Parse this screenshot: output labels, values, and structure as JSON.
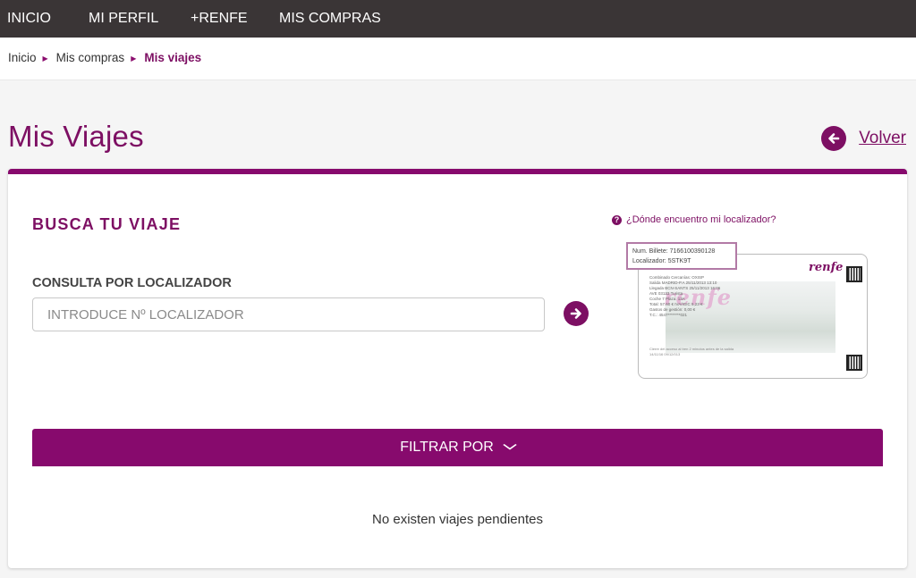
{
  "nav": {
    "items": [
      {
        "label": "INICIO"
      },
      {
        "label": "MI PERFIL"
      },
      {
        "label": "+RENFE"
      },
      {
        "label": "MIS COMPRAS"
      }
    ]
  },
  "breadcrumb": {
    "items": [
      "Inicio",
      "Mis compras"
    ],
    "current": "Mis viajes",
    "separator_icon": "triangle-right-icon"
  },
  "page": {
    "title": "Mis Viajes",
    "back_label": "Volver",
    "back_icon": "arrow-left-circle-icon"
  },
  "search": {
    "section_title": "BUSCA TU VIAJE",
    "field_label": "CONSULTA POR LOCALIZADOR",
    "placeholder": "INTRODUCE Nº LOCALIZADOR",
    "value": "",
    "submit_icon": "arrow-right-circle-icon",
    "help_link": "¿Dónde encuentro mi localizador?"
  },
  "ticket_example": {
    "callout_line1": "Num. Billete: 7166100390128",
    "callout_line2": "Localizador: 5STK9T",
    "brand": "renfe",
    "lines": [
      "Combinado Cercanías: OXISP",
      "Salida        MADRID-P.A       25/11/2013      13:10",
      "Llegada       BCN-SANTS        25/11/2013      16:06",
      "AVE           03133            Turista",
      "Coche         7                Plaza: 13A",
      "",
      "                Total: 57,60 € IVA/IGIC 5,23 €",
      "                Gastos de gestión: 0,00 €"
    ],
    "footer_lines": [
      "Cierre del acceso al tren 2 minutos antes de la salida",
      "14/11/16 09/12/013"
    ],
    "card_hint": "T.C.: 4547********021"
  },
  "filter": {
    "label": "FILTRAR POR",
    "chevron_icon": "chevron-down-icon"
  },
  "results": {
    "empty_message": "No existen viajes pendientes"
  },
  "colors": {
    "brand": "#870a6d",
    "topbar": "#3a3536",
    "title": "#7d0f63"
  }
}
